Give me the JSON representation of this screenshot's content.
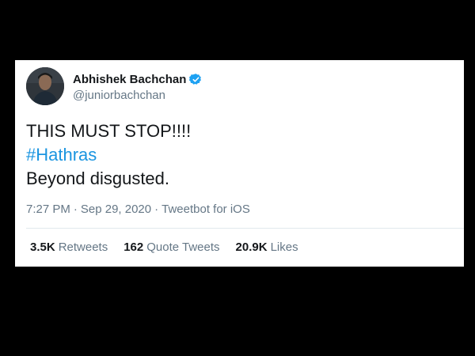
{
  "user": {
    "display_name": "Abhishek Bachchan",
    "handle": "@juniorbachchan",
    "verified": true
  },
  "tweet": {
    "line1": "THIS MUST STOP!!!!",
    "hashtag": "#Hathras",
    "line3": "Beyond disgusted."
  },
  "meta": {
    "time": "7:27 PM",
    "separator": "·",
    "date": "Sep 29, 2020",
    "source": "Tweetbot for iOS"
  },
  "stats": {
    "retweets_count": "3.5K",
    "retweets_label": "Retweets",
    "quotes_count": "162",
    "quotes_label": "Quote Tweets",
    "likes_count": "20.9K",
    "likes_label": "Likes"
  },
  "colors": {
    "link": "#1b95e0",
    "verified_badge": "#1da1f2",
    "secondary_text": "#657786",
    "page_background": "#000000"
  }
}
